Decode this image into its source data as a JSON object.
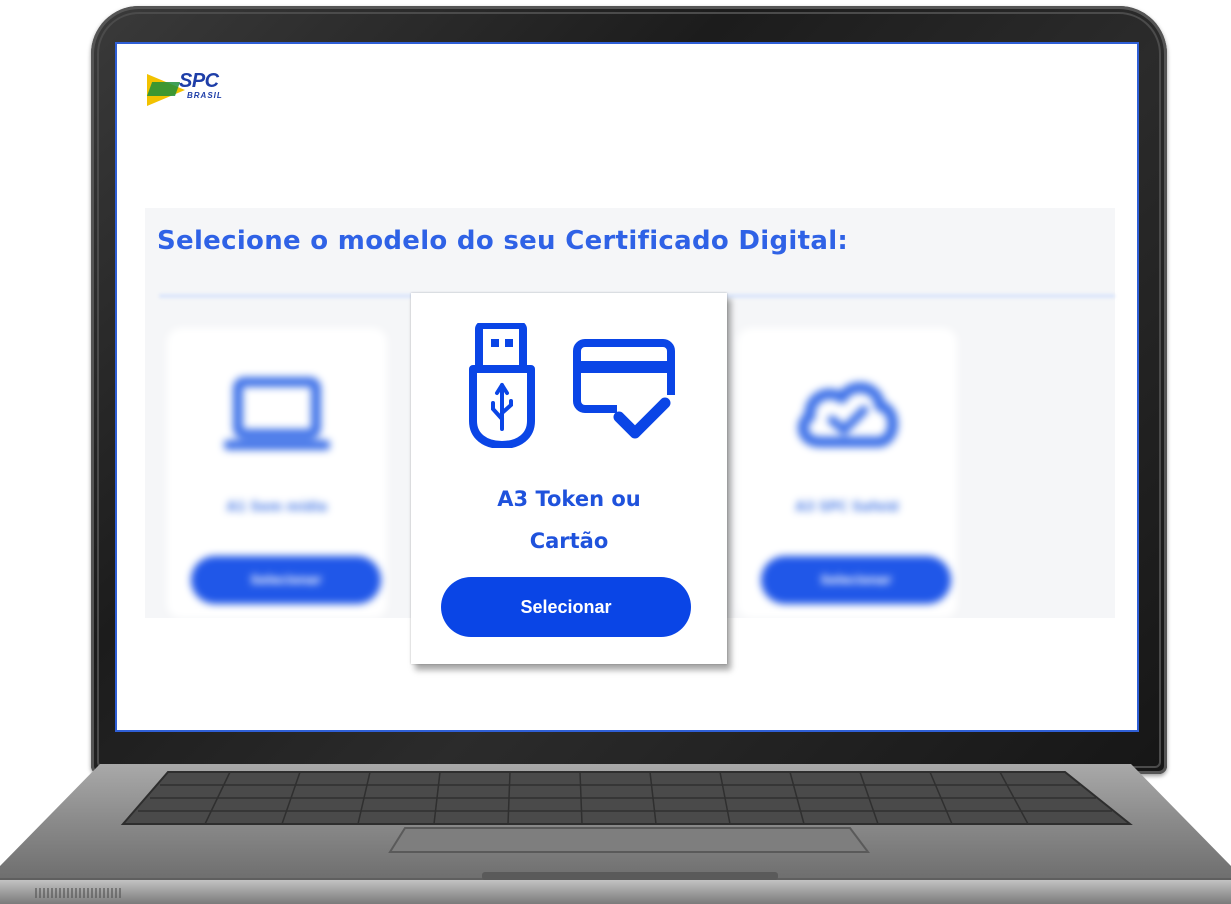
{
  "brand": {
    "name": "SPC",
    "subtitle": "BRASIL"
  },
  "heading": "Selecione o modelo do seu Certificado Digital:",
  "cards": [
    {
      "label": "A1 Sem mídia",
      "icon": "laptop-icon",
      "button": "Selecionar",
      "blurred": true
    },
    {
      "label_line1": "A3 Token ou",
      "label_line2": "Cartão",
      "icon": "usb-token-and-card-icon",
      "button": "Selecionar",
      "blurred": false
    },
    {
      "label": "A3 SPC Safeid",
      "icon": "cloud-check-icon",
      "button": "Selecionar",
      "blurred": true
    }
  ],
  "colors": {
    "accent": "#0a45e6",
    "heading": "#2f62e6",
    "bezel": "#1c1c1c",
    "logo_yellow": "#f2c200",
    "logo_blue": "#1e3ea8"
  }
}
